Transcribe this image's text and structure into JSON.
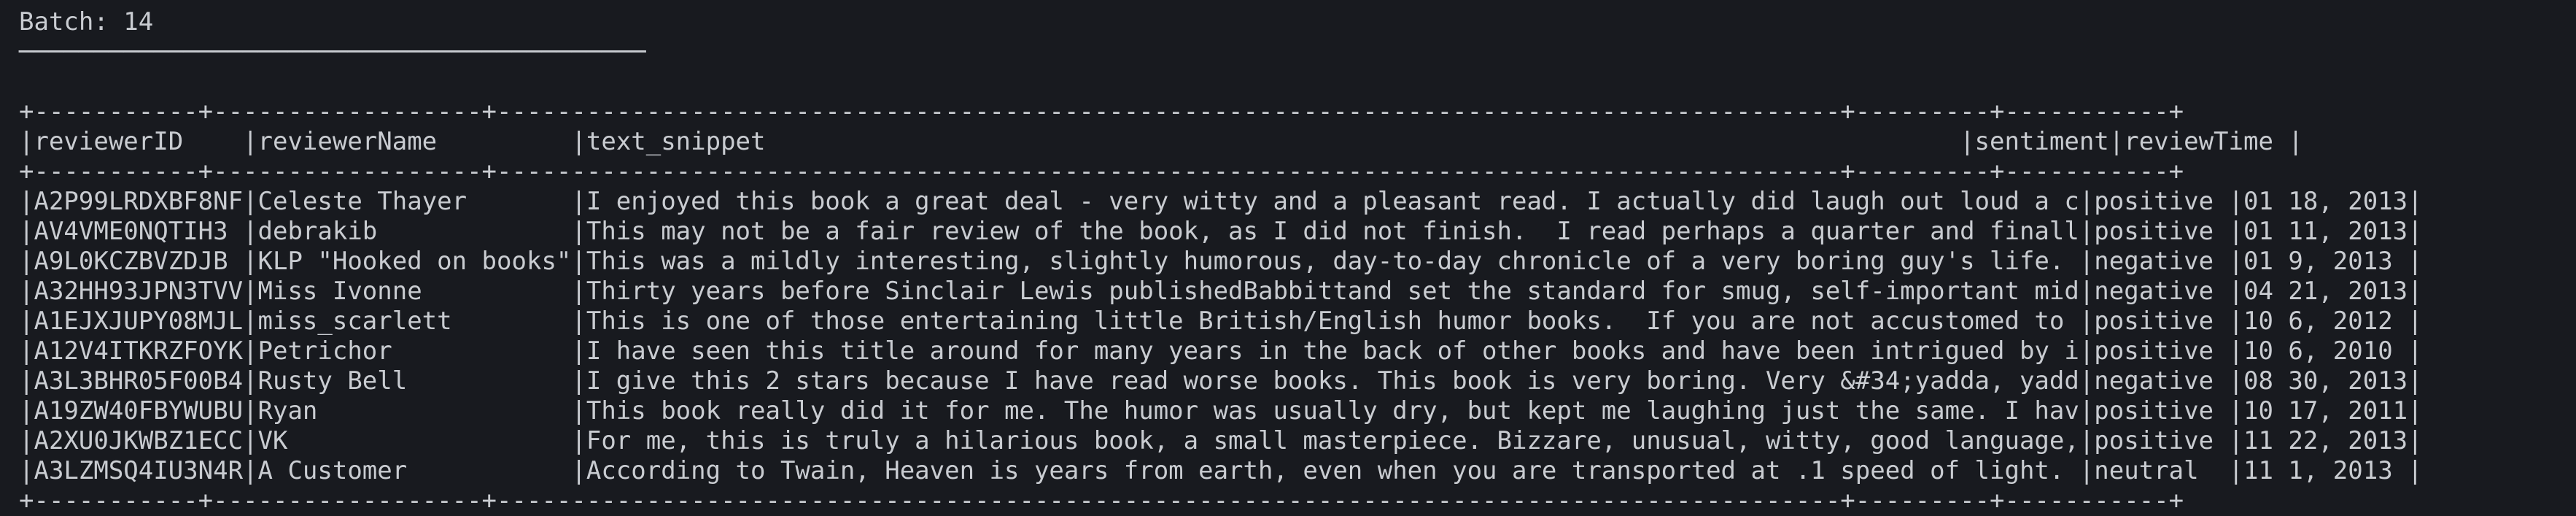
{
  "batch_label": "Batch: 14",
  "underline": "──────────────────────────────────────────",
  "table": {
    "border_line": "+-----------+------------------+------------------------------------------------------------------------------------------+---------+-----------+",
    "header_line": "|reviewerID    |reviewerName         |text_snippet                                                                                |sentiment|reviewTime |",
    "columns": [
      "reviewerID",
      "reviewerName",
      "text_snippet",
      "sentiment",
      "reviewTime"
    ],
    "rows": [
      "|A2P99LRDXBF8NF|Celeste Thayer       |I enjoyed this book a great deal - very witty and a pleasant read. I actually did laugh out loud a c|positive |01 18, 2013|",
      "|AV4VME0NQTIH3 |debrakib             |This may not be a fair review of the book, as I did not finish.  I read perhaps a quarter and finall|positive |01 11, 2013|",
      "|A9L0KCZBVZDJB |KLP \"Hooked on books\"|This was a mildly interesting, slightly humorous, day-to-day chronicle of a very boring guy's life. |negative |01 9, 2013 |",
      "|A32HH93JPN3TVV|Miss Ivonne          |Thirty years before Sinclair Lewis publishedBabbittand set the standard for smug, self-important mid|negative |04 21, 2013|",
      "|A1EJXJUPY08MJL|miss_scarlett        |This is one of those entertaining little British/English humor books.  If you are not accustomed to |positive |10 6, 2012 |",
      "|A12V4ITKRZFOYK|Petrichor            |I have seen this title around for many years in the back of other books and have been intrigued by i|positive |10 6, 2010 |",
      "|A3L3BHR05F00B4|Rusty Bell           |I give this 2 stars because I have read worse books. This book is very boring. Very &#34;yadda, yadd|negative |08 30, 2013|",
      "|A19ZW40FBYWUBU|Ryan                 |This book really did it for me. The humor was usually dry, but kept me laughing just the same. I hav|positive |10 17, 2011|",
      "|A2XU0JKWBZ1ECC|VK                   |For me, this is truly a hilarious book, a small masterpiece. Bizzare, unusual, witty, good language,|positive |11 22, 2013|",
      "|A3LZMSQ4IU3N4R|A Customer           |According to Twain, Heaven is years from earth, even when you are transported at .1 speed of light. |neutral  |11 1, 2013 |"
    ]
  }
}
